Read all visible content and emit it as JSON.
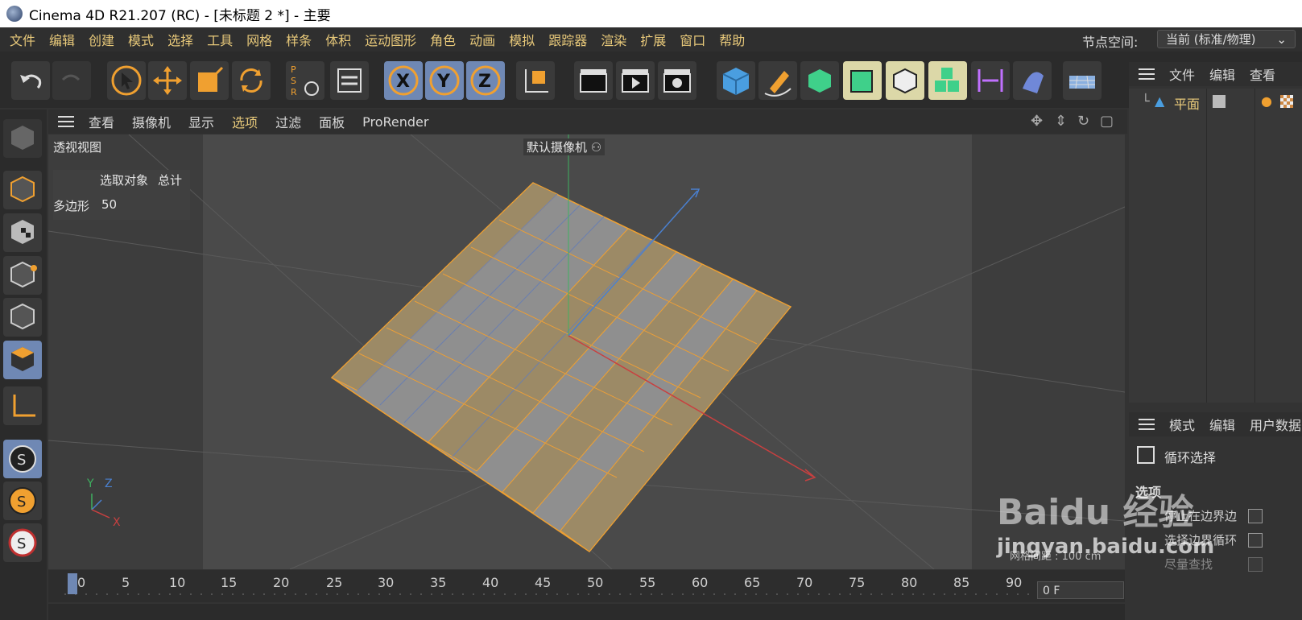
{
  "window": {
    "title": "Cinema 4D R21.207 (RC) - [未标题 2 *] - 主要"
  },
  "menu": {
    "items": [
      "文件",
      "编辑",
      "创建",
      "模式",
      "选择",
      "工具",
      "网格",
      "样条",
      "体积",
      "运动图形",
      "角色",
      "动画",
      "模拟",
      "跟踪器",
      "渲染",
      "扩展",
      "窗口",
      "帮助"
    ],
    "node_space_label": "节点空间:",
    "node_space_value": "当前 (标准/物理)"
  },
  "viewport": {
    "menu": [
      "查看",
      "摄像机",
      "显示",
      "选项",
      "过滤",
      "面板",
      "ProRender"
    ],
    "selected_menu": "选项",
    "view_name": "透视视图",
    "camera_label": "默认摄像机",
    "stats": {
      "col1": "选取对象",
      "col2": "总计",
      "row_label": "多边形",
      "row_value": "50"
    },
    "grid_spacing": "网格间距 : 100 cm",
    "axis": {
      "y": "Y",
      "z": "Z",
      "x": "X"
    }
  },
  "timeline": {
    "ticks": [
      "0",
      "5",
      "10",
      "15",
      "20",
      "25",
      "30",
      "35",
      "40",
      "45",
      "50",
      "55",
      "60",
      "65",
      "70",
      "75",
      "80",
      "85",
      "90"
    ],
    "frame_field": "0 F"
  },
  "object_manager": {
    "menu": [
      "文件",
      "编辑",
      "查看"
    ],
    "object_name": "平面"
  },
  "attribute_manager": {
    "menu": [
      "模式",
      "编辑",
      "用户数据"
    ],
    "tool_name": "循环选择",
    "section": "选项",
    "options": [
      "停止在边界边",
      "选择边界循环",
      "尽量查找"
    ]
  },
  "watermark": {
    "text": "Baidu 经验",
    "url": "jingyan.baidu.com"
  },
  "colors": {
    "accent": "#e8c97a",
    "selection_orange": "#f0a030",
    "button_blue": "#6f88b4"
  }
}
